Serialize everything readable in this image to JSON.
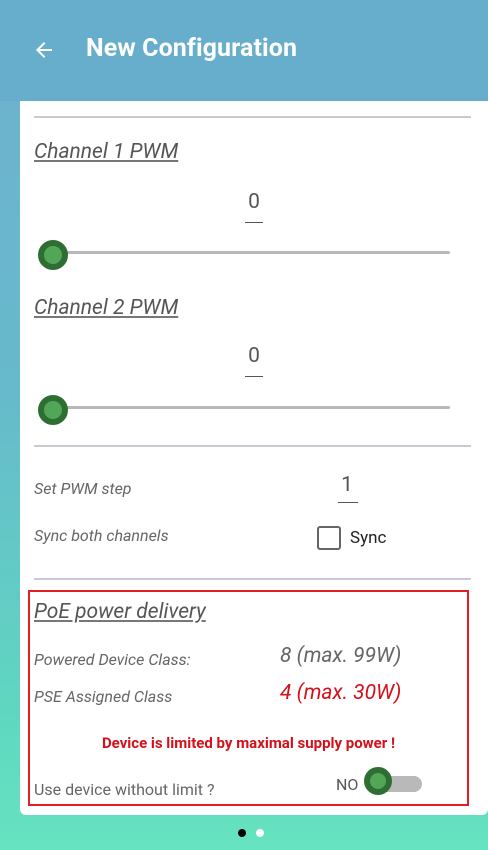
{
  "header": {
    "title": "New Configuration"
  },
  "channel1": {
    "title": "Channel 1 PWM",
    "value": "0",
    "slider_level": 0
  },
  "channel2": {
    "title": "Channel 2 PWM",
    "value": "0",
    "slider_level": 0
  },
  "pwm_step": {
    "label": "Set PWM step",
    "value": "1"
  },
  "sync": {
    "label": "Sync both channels",
    "checkbox_label": "Sync",
    "checked": false
  },
  "poe": {
    "title": "PoE power delivery",
    "powered_device_label": "Powered Device Class:",
    "powered_device_value": "8 (max. 99W)",
    "pse_label": "PSE Assigned Class",
    "pse_value": "4 (max. 30W)",
    "warning": "Device is limited by maximal supply power !",
    "without_limit_label": "Use device without limit ?",
    "toggle_label": "NO",
    "toggle_on": false
  },
  "pager": {
    "count": 2,
    "active_index": 0
  },
  "colors": {
    "header_bg": "#67aecd",
    "accent_green": "#52a657",
    "warning_red": "#d4101a",
    "border_red": "#e21f26"
  }
}
